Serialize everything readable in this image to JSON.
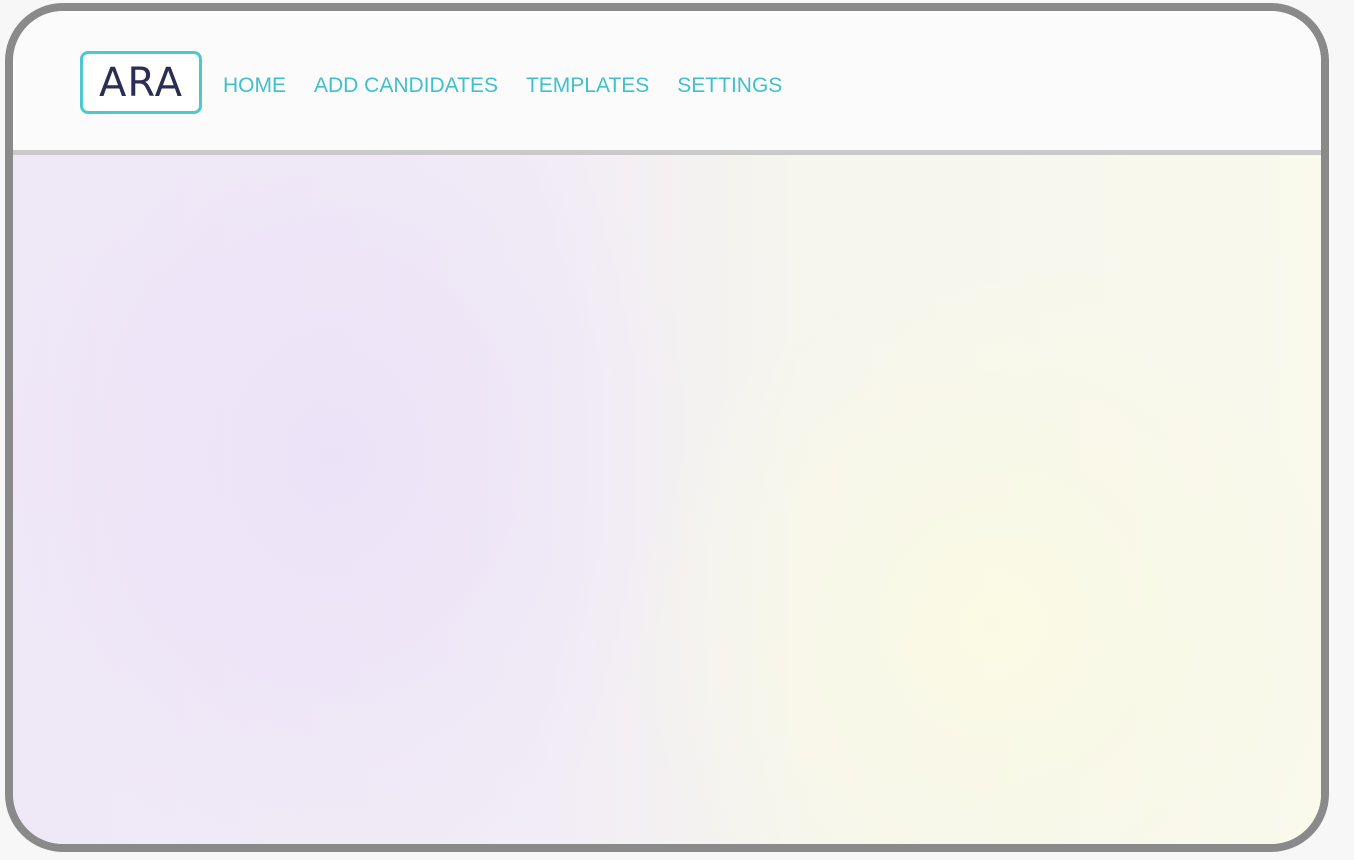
{
  "app": {
    "logo_text": "ARA"
  },
  "nav": {
    "items": [
      {
        "label": "HOME"
      },
      {
        "label": "ADD CANDIDATES"
      },
      {
        "label": "TEMPLATES"
      },
      {
        "label": "SETTINGS"
      }
    ]
  },
  "colors": {
    "accent": "#3fc0cb",
    "logo_text": "#2b2d55",
    "frame_border": "#8a8a8a"
  }
}
